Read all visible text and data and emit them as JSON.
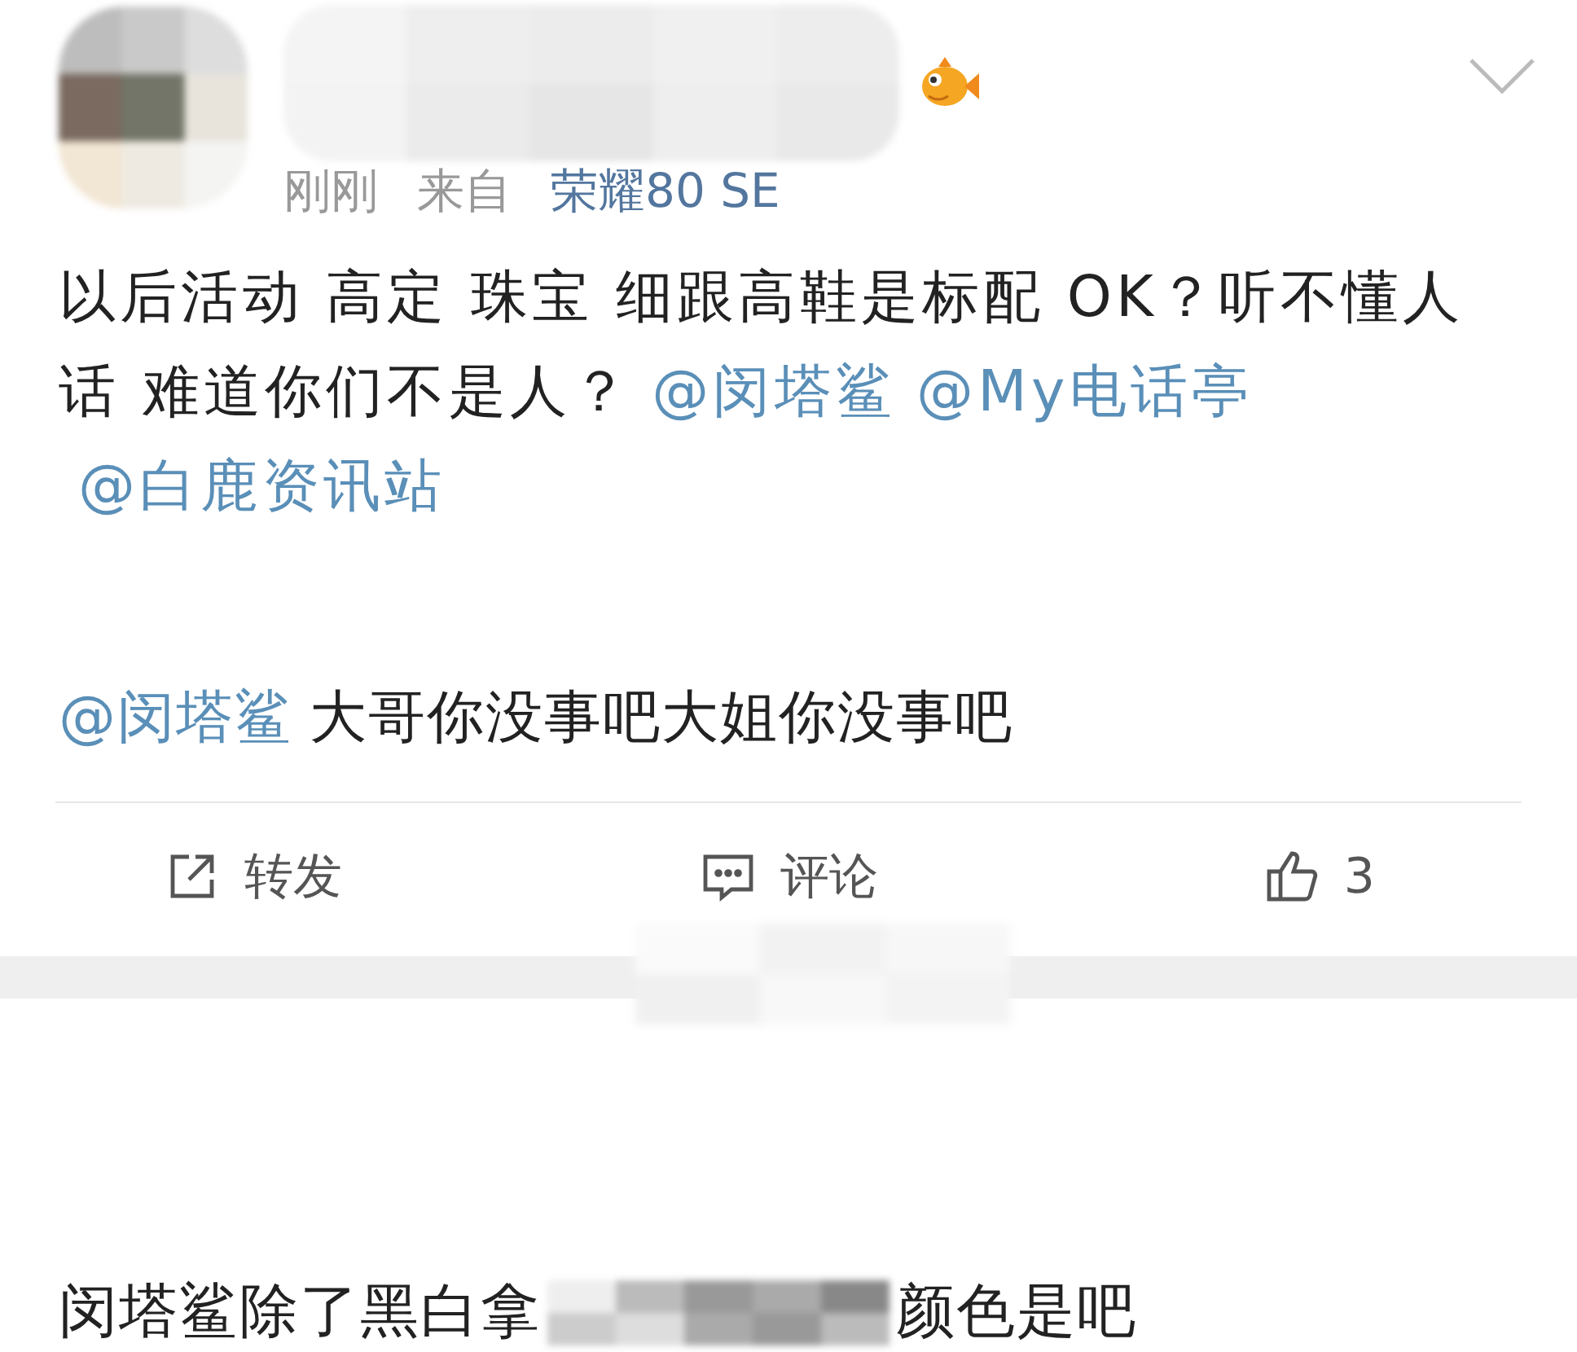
{
  "post": {
    "time": "刚刚",
    "source_label": "来自",
    "device": "荣耀80 SE",
    "content": [
      {
        "kind": "text",
        "text": "以后活动 高定 珠宝 细跟高鞋是标配 OK？听不懂人话 难道你们不是人？"
      },
      {
        "kind": "mention",
        "text": "@闵塔鲨"
      },
      {
        "kind": "mention",
        "text": "@My电话亭"
      },
      {
        "kind": "mention",
        "text": "@白鹿资讯站"
      }
    ],
    "reply": [
      {
        "kind": "mention",
        "text": "@闵塔鲨"
      },
      {
        "kind": "text",
        "text": "大哥你没事吧大姐你没事吧"
      }
    ]
  },
  "actions": [
    {
      "kind": "repost",
      "label": "转发"
    },
    {
      "kind": "comment",
      "label": "评论"
    },
    {
      "kind": "like",
      "label": "3"
    }
  ],
  "next_comment": {
    "parts": [
      "闵塔鲨除了黑白拿",
      "颜色是吧"
    ]
  }
}
